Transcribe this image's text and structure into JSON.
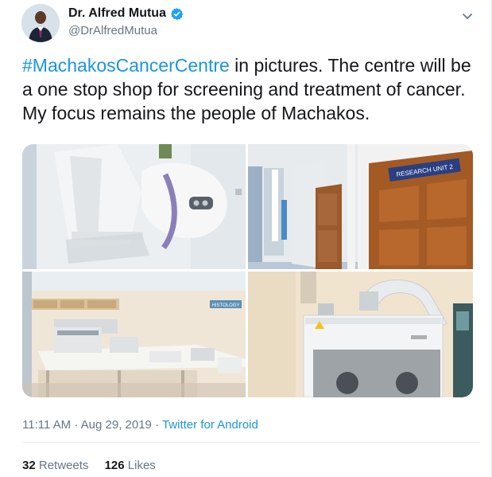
{
  "author": {
    "name": "Dr. Alfred Mutua",
    "handle": "@DrAlfredMutua",
    "verified": true,
    "verified_color": "#1da1f2"
  },
  "tweet": {
    "hashtag": "#MachakosCancerCentre",
    "text": " in pictures. The centre will be a one stop shop for screening and treatment of cancer. My focus remains the people of Machakos."
  },
  "media": {
    "sign_research": "RESEARCH UNIT 2",
    "sign_histology": "HISTOLOGY"
  },
  "meta": {
    "timestamp": "11:11 AM · Aug 29, 2019",
    "separator": " · ",
    "source": "Twitter for Android"
  },
  "stats": {
    "retweets_count": "32",
    "retweets_label": "Retweets",
    "likes_count": "126",
    "likes_label": "Likes"
  },
  "colors": {
    "text": "#14171a",
    "secondary": "#657786",
    "link": "#1b95e0",
    "divider": "#e6ecf0"
  }
}
